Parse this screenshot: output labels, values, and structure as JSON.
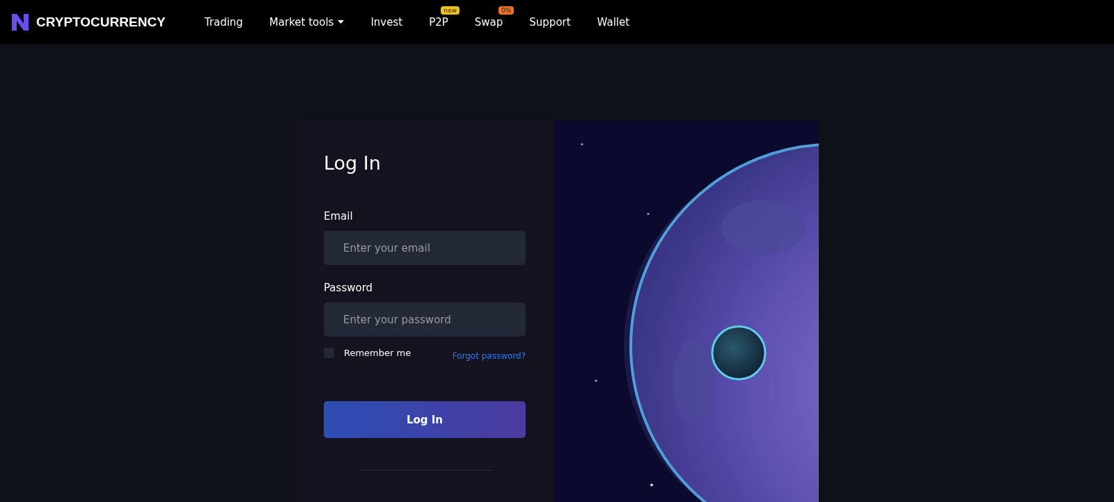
{
  "brand": {
    "name": "CRYPTOCURRENCY"
  },
  "nav": [
    {
      "label": "Trading",
      "has_menu": false
    },
    {
      "label": "Market tools",
      "has_menu": true
    },
    {
      "label": "Invest",
      "has_menu": false
    },
    {
      "label": "P2P",
      "has_menu": false,
      "badge": {
        "text": "new",
        "color": "#f0c419"
      }
    },
    {
      "label": "Swap",
      "has_menu": false,
      "badge": {
        "text": "0%",
        "color": "#f07323"
      }
    },
    {
      "label": "Support",
      "has_menu": false
    },
    {
      "label": "Wallet",
      "has_menu": false
    }
  ],
  "login": {
    "title": "Log In",
    "fields": [
      {
        "label": "Email",
        "placeholder": "Enter your email"
      },
      {
        "label": "Password",
        "placeholder": "Enter your password"
      }
    ],
    "remember": {
      "label": "Remember me",
      "checked": false
    },
    "forgot": "Forgot password?",
    "submit": "Log In"
  }
}
